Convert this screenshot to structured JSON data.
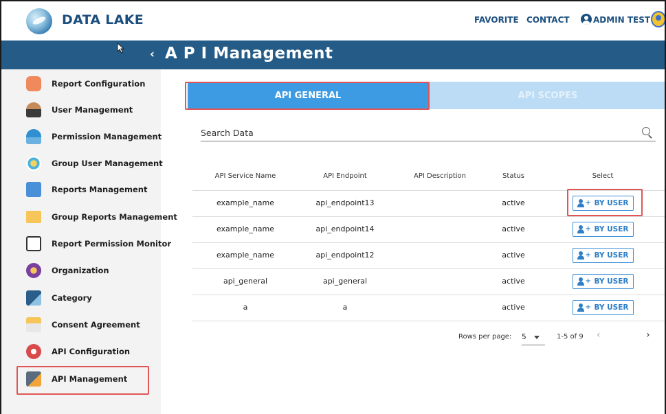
{
  "header": {
    "brand": "DATA LAKE",
    "favorite": "FAVORITE",
    "contact": "CONTACT",
    "user": "ADMIN TEST"
  },
  "titlebar": {
    "back": "‹",
    "title": "A P I Management"
  },
  "sidebar": {
    "items": [
      {
        "label": "Report Configuration",
        "icon": "report-config-icon"
      },
      {
        "label": "User Management",
        "icon": "user-management-icon"
      },
      {
        "label": "Permission Management",
        "icon": "permission-icon"
      },
      {
        "label": "Group User Management",
        "icon": "group-user-icon"
      },
      {
        "label": "Reports Management",
        "icon": "reports-icon"
      },
      {
        "label": "Group Reports Management",
        "icon": "folder-icon"
      },
      {
        "label": "Report Permission Monitor",
        "icon": "monitor-icon"
      },
      {
        "label": "Organization",
        "icon": "organization-icon"
      },
      {
        "label": "Category",
        "icon": "category-icon"
      },
      {
        "label": "Consent Agreement",
        "icon": "consent-icon"
      },
      {
        "label": "API Configuration",
        "icon": "api-config-icon"
      },
      {
        "label": "API Management",
        "icon": "api-management-icon"
      }
    ],
    "active": "API Management"
  },
  "tabs": {
    "general": "API GENERAL",
    "scopes": "API SCOPES"
  },
  "search": {
    "placeholder": "Search Data"
  },
  "table": {
    "headers": [
      "API Service Name",
      "API Endpoint",
      "API Description",
      "Status",
      "Select"
    ],
    "button_label": "BY USER",
    "rows": [
      {
        "name": "example_name",
        "endpoint": "api_endpoint13",
        "description": "",
        "status": "active"
      },
      {
        "name": "example_name",
        "endpoint": "api_endpoint14",
        "description": "",
        "status": "active"
      },
      {
        "name": "example_name",
        "endpoint": "api_endpoint12",
        "description": "",
        "status": "active"
      },
      {
        "name": "api_general",
        "endpoint": "api_general",
        "description": "",
        "status": "active"
      },
      {
        "name": "a",
        "endpoint": "a",
        "description": "",
        "status": "active"
      }
    ]
  },
  "pagination": {
    "rows_per_page_label": "Rows per page:",
    "rows_per_page": "5",
    "range": "1-5 of 9",
    "prev": "‹",
    "next": "›"
  },
  "colors": {
    "titlebar": "#245b87",
    "tab_active": "#3d9be3",
    "tab_inactive": "#bcdcf5",
    "highlight": "#e05555"
  }
}
